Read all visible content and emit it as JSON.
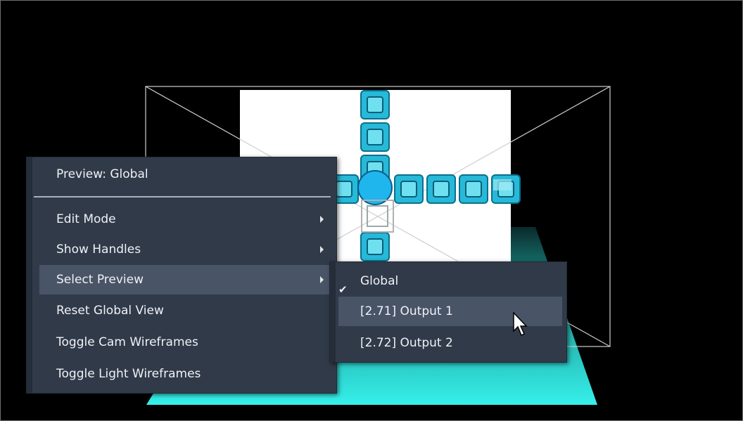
{
  "menu": {
    "title": "Preview: Global",
    "items": [
      {
        "label": "Edit Mode",
        "submenu": true
      },
      {
        "label": "Show Handles",
        "submenu": true
      },
      {
        "label": "Select Preview",
        "submenu": true
      },
      {
        "label": "Reset Global View",
        "submenu": false
      },
      {
        "label": "Toggle Cam Wireframes",
        "submenu": false
      },
      {
        "label": "Toggle Light Wireframes",
        "submenu": false
      }
    ]
  },
  "submenu": {
    "items": [
      {
        "label": "Global",
        "checked": true
      },
      {
        "label": "[2.71] Output 1",
        "checked": false
      },
      {
        "label": "[2.72] Output 2",
        "checked": false
      }
    ]
  },
  "colors": {
    "menu_bg": "#313a49",
    "menu_highlight": "#4a5467",
    "floor": "#2ee6e0",
    "tile": "#27b9d8"
  }
}
